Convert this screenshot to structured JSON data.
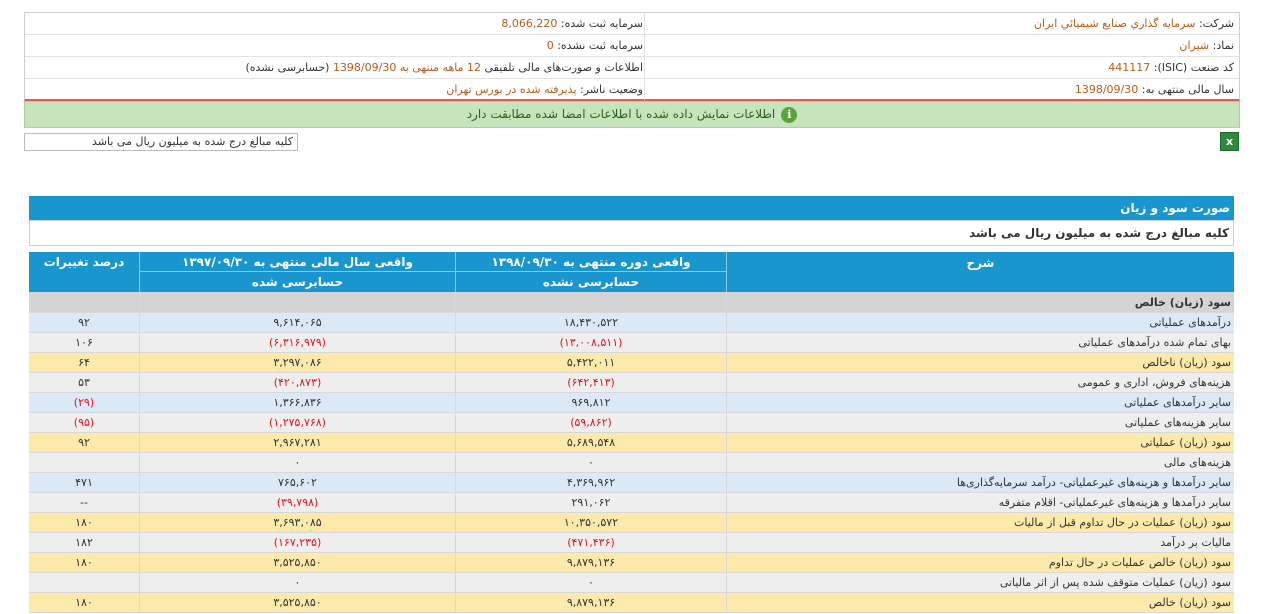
{
  "header": {
    "company_label": "شرکت:",
    "company_value": "سرمايه گذاري صنايع شيميائي ايران",
    "capital_reg_label": "سرمایه ثبت شده:",
    "capital_reg_value": "8,066,220",
    "symbol_label": "نماد:",
    "symbol_value": "شيران",
    "capital_unreg_label": "سرمایه ثبت نشده:",
    "capital_unreg_value": "0",
    "isic_label": "کد صنعت (ISIC):",
    "isic_value": "441117",
    "report_desc_prefix": "اطلاعات و صورت‌های مالی تلفیقی",
    "report_desc_period": "12 ماهه منتهی به 1398/09/30",
    "report_desc_suffix": "(حسابرسی نشده)",
    "fiscal_label": "سال مالی منتهی به:",
    "fiscal_value": "1398/09/30",
    "publisher_label": "وضعیت ناشر:",
    "publisher_value": "پذیرفته شده در بورس تهران"
  },
  "notice": {
    "icon": "info-icon",
    "text": "اطلاعات نمایش داده شده با اطلاعات امضا شده مطابقت دارد"
  },
  "toolbar": {
    "excel_icon": "excel-export-icon",
    "unit_text": "کلیه مبالغ درج شده به میلیون ریال می باشد"
  },
  "statement": {
    "title": "صورت سود و زیان",
    "unit_text": "کلیه مبالغ درج شده به میلیون ریال می باشد",
    "headers": {
      "desc": "شرح",
      "col1_top": "واقعی دوره منتهی به ۱۳۹۸/۰۹/۳۰",
      "col1_bottom": "حسابرسی نشده",
      "col2_top": "واقعی سال مالی منتهی به ۱۳۹۷/۰۹/۳۰",
      "col2_bottom": "حسابرسی شده",
      "col3": "درصد تغییرات"
    },
    "section_row": "سود (زیان) خالص",
    "rows": [
      {
        "desc": "درآمدهای عملیاتی",
        "v1": "۱۸,۴۳۰,۵۲۲",
        "v2": "۹,۶۱۴,۰۶۵",
        "pct": "۹۲",
        "style": "blue",
        "n1": false,
        "n2": false,
        "np": false
      },
      {
        "desc": "بهای تمام شده درآمدهای عملیاتی",
        "v1": "(۱۳,۰۰۸,۵۱۱)",
        "v2": "(۶,۳۱۶,۹۷۹)",
        "pct": "۱۰۶",
        "style": "gray",
        "n1": true,
        "n2": true,
        "np": false
      },
      {
        "desc": "سود (زیان) ناخالص",
        "v1": "۵,۴۲۲,۰۱۱",
        "v2": "۳,۲۹۷,۰۸۶",
        "pct": "۶۴",
        "style": "yellow",
        "n1": false,
        "n2": false,
        "np": false
      },
      {
        "desc": "هزینه‌های فروش، اداری و عمومی",
        "v1": "(۶۴۲,۴۱۳)",
        "v2": "(۴۲۰,۸۷۳)",
        "pct": "۵۳",
        "style": "gray",
        "n1": true,
        "n2": true,
        "np": false
      },
      {
        "desc": "سایر درآمدهای عملیاتی",
        "v1": "۹۶۹,۸۱۲",
        "v2": "۱,۳۶۶,۸۳۶",
        "pct": "(۲۹)",
        "style": "blue",
        "n1": false,
        "n2": false,
        "np": true
      },
      {
        "desc": "سایر هزینه‌های عملیاتی",
        "v1": "(۵۹,۸۶۲)",
        "v2": "(۱,۲۷۵,۷۶۸)",
        "pct": "(۹۵)",
        "style": "gray",
        "n1": true,
        "n2": true,
        "np": true
      },
      {
        "desc": "سود (زیان) عملیاتی",
        "v1": "۵,۶۸۹,۵۴۸",
        "v2": "۲,۹۶۷,۲۸۱",
        "pct": "۹۲",
        "style": "yellow",
        "n1": false,
        "n2": false,
        "np": false
      },
      {
        "desc": "هزینه‌های مالی",
        "v1": "۰",
        "v2": "۰",
        "pct": "",
        "style": "gray",
        "n1": false,
        "n2": false,
        "np": false
      },
      {
        "desc": "سایر درآمدها و هزینه‌های غیرعملیاتی- درآمد سرمایه‌گذاری‌ها",
        "v1": "۴,۳۶۹,۹۶۲",
        "v2": "۷۶۵,۶۰۲",
        "pct": "۴۷۱",
        "style": "blue",
        "n1": false,
        "n2": false,
        "np": false
      },
      {
        "desc": "سایر درآمدها و هزینه‌های غیرعملیاتی- اقلام متفرقه",
        "v1": "۲۹۱,۰۶۲",
        "v2": "(۳۹,۷۹۸)",
        "pct": "--",
        "style": "gray",
        "n1": false,
        "n2": true,
        "np": false
      },
      {
        "desc": "سود (زیان) عملیات در حال تداوم قبل از مالیات",
        "v1": "۱۰,۳۵۰,۵۷۲",
        "v2": "۳,۶۹۳,۰۸۵",
        "pct": "۱۸۰",
        "style": "yellow",
        "n1": false,
        "n2": false,
        "np": false
      },
      {
        "desc": "مالیات بر درآمد",
        "v1": "(۴۷۱,۴۳۶)",
        "v2": "(۱۶۷,۲۳۵)",
        "pct": "۱۸۲",
        "style": "gray",
        "n1": true,
        "n2": true,
        "np": false
      },
      {
        "desc": "سود (زیان) خالص عملیات در حال تداوم",
        "v1": "۹,۸۷۹,۱۳۶",
        "v2": "۳,۵۲۵,۸۵۰",
        "pct": "۱۸۰",
        "style": "yellow",
        "n1": false,
        "n2": false,
        "np": false
      },
      {
        "desc": "سود (زیان) عملیات متوقف شده پس از اثر مالیاتی",
        "v1": "۰",
        "v2": "۰",
        "pct": "",
        "style": "gray",
        "n1": false,
        "n2": false,
        "np": false
      },
      {
        "desc": "سود (زیان) خالص",
        "v1": "۹,۸۷۹,۱۳۶",
        "v2": "۳,۵۲۵,۸۵۰",
        "pct": "۱۸۰",
        "style": "yellow",
        "n1": false,
        "n2": false,
        "np": false
      }
    ]
  },
  "colors": {
    "blue_row": "#dbe8f6",
    "gray_row": "#eeeeee",
    "yellow_row": "#fde9a9",
    "section_row": "#d4d4d4",
    "header_blue": "#1a96ce"
  }
}
